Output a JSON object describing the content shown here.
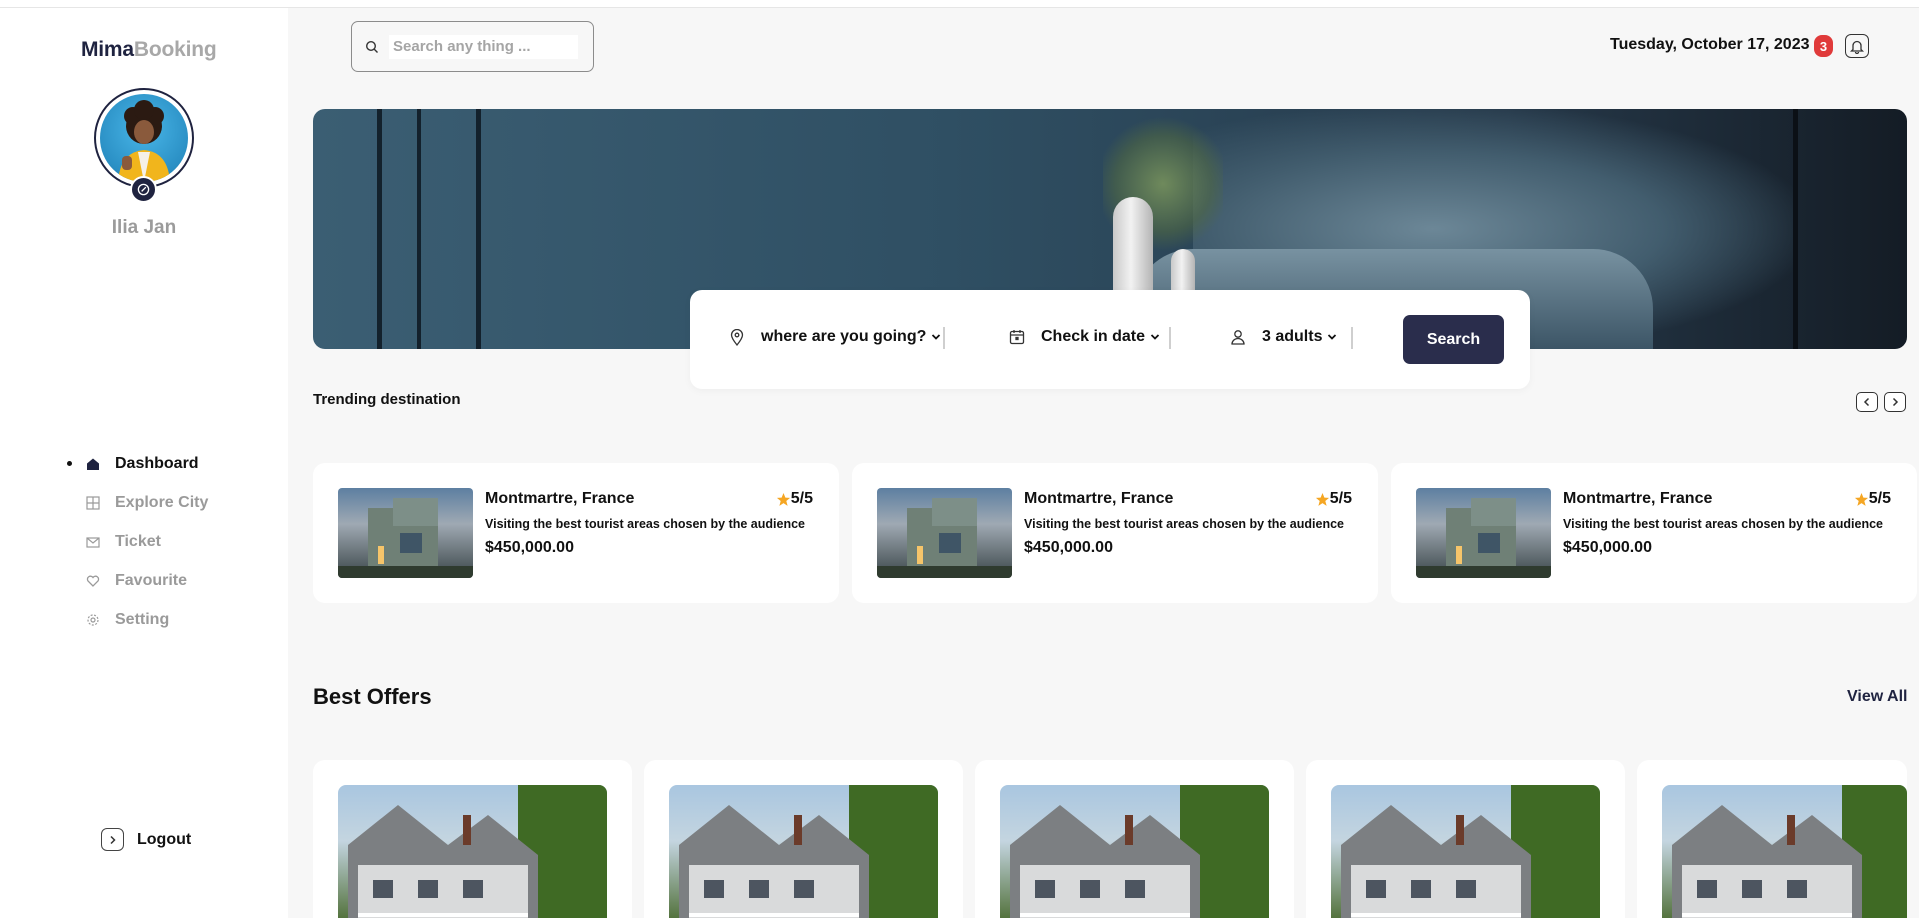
{
  "brand": {
    "part1": "Mima",
    "part2": "Booking"
  },
  "user": {
    "name": "Ilia Jan"
  },
  "nav": [
    {
      "label": "Dashboard",
      "icon": "home-icon",
      "active": true
    },
    {
      "label": "Explore City",
      "icon": "grid-icon",
      "active": false
    },
    {
      "label": "Ticket",
      "icon": "mail-icon",
      "active": false
    },
    {
      "label": "Favourite",
      "icon": "heart-icon",
      "active": false
    },
    {
      "label": "Setting",
      "icon": "gear-icon",
      "active": false
    }
  ],
  "logout_label": "Logout",
  "header": {
    "search_placeholder": "Search any thing ...",
    "date": "Tuesday, October 17, 2023",
    "notifications": "3"
  },
  "booking": {
    "destination": "where are you going?",
    "checkin": "Check in date",
    "guests": "3 adults",
    "search_label": "Search"
  },
  "trending": {
    "title": "Trending destination",
    "cards": [
      {
        "title": "Montmartre, France",
        "rating": "5/5",
        "desc": "Visiting the best tourist areas chosen by the audience",
        "price": "$450,000.00"
      },
      {
        "title": "Montmartre, France",
        "rating": "5/5",
        "desc": "Visiting the best tourist areas chosen by the audience",
        "price": "$450,000.00"
      },
      {
        "title": "Montmartre, France",
        "rating": "5/5",
        "desc": "Visiting the best tourist areas chosen by the audience",
        "price": "$450,000.00"
      }
    ]
  },
  "offers": {
    "title": "Best Offers",
    "view_all": "View All"
  },
  "colors": {
    "brand_dark": "#1f2340",
    "button": "#2a2d4c",
    "badge": "#e03a3a",
    "star": "#f5a623"
  }
}
